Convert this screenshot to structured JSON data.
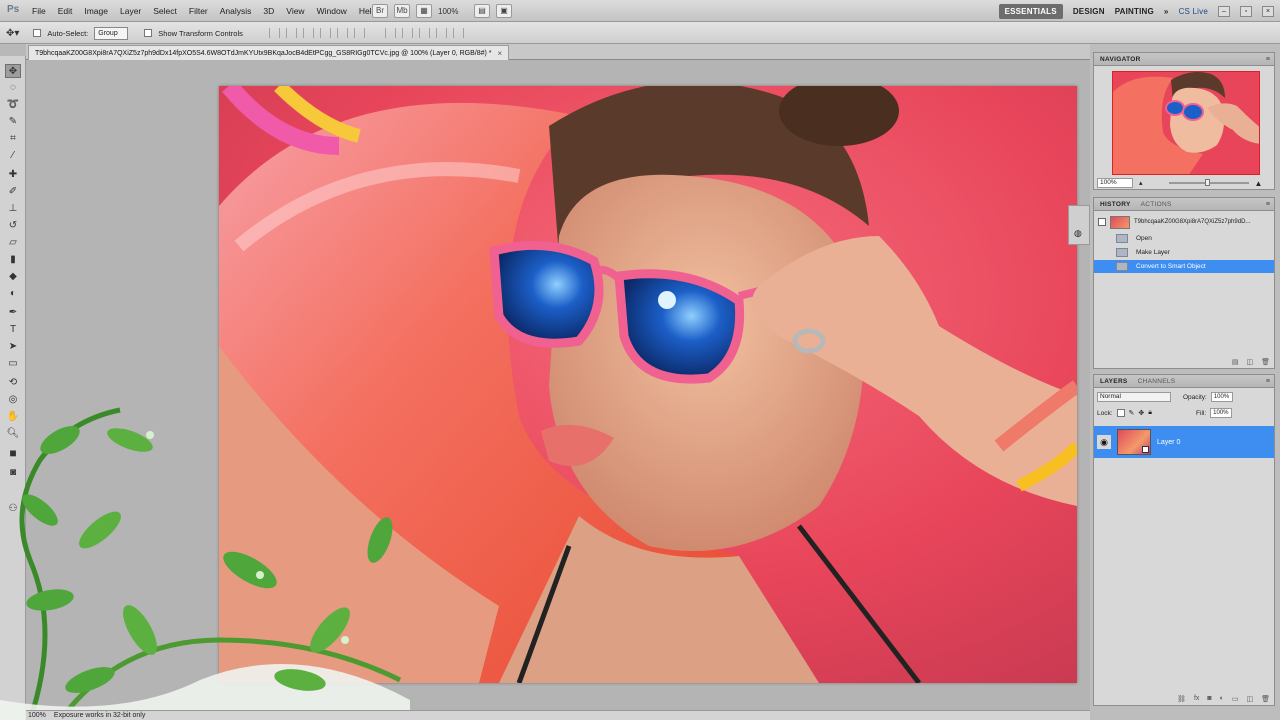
{
  "app": {
    "logo": "Ps"
  },
  "menu": [
    "File",
    "Edit",
    "Image",
    "Layer",
    "Select",
    "Filter",
    "Analysis",
    "3D",
    "View",
    "Window",
    "Help"
  ],
  "menu_tools": {
    "zoom": "100%"
  },
  "workspaces": {
    "active": "ESSENTIALS",
    "items": [
      "DESIGN",
      "PAINTING"
    ],
    "more": "»",
    "cslive": "CS Live"
  },
  "options": {
    "auto_select_label": "Auto-Select:",
    "auto_select_value": "Group",
    "transform_label": "Show Transform Controls"
  },
  "document": {
    "tab_title": "T9bhcqaaKZ00G8Xpi8rA7QXiZ5z7ph9dDx14fpXO5S4.6W8OTdJmKYUtx9BKqaJocB4dEtPCgg_GS8RIGg0TCVc.jpg @ 100% (Layer 0, RGB/8#) *",
    "close": "×"
  },
  "status": {
    "zoom": "100%",
    "message": "Exposure works in 32-bit only"
  },
  "panels": {
    "navigator": {
      "tab": "NAVIGATOR",
      "zoom": "100%"
    },
    "history": {
      "tabs": [
        "HISTORY",
        "ACTIONS"
      ],
      "snapshot": "T9bhcqaaKZ00G8Xpi8rA7QXiZ5z7ph9dD...",
      "items": [
        "Open",
        "Make Layer",
        "Convert to Smart Object"
      ]
    },
    "layers": {
      "tabs": [
        "LAYERS",
        "CHANNELS"
      ],
      "blend_mode": "Normal",
      "opacity_label": "Opacity:",
      "opacity_value": "100%",
      "lock_label": "Lock:",
      "fill_label": "Fill:",
      "fill_value": "100%",
      "layer_name": "Layer 0"
    }
  }
}
